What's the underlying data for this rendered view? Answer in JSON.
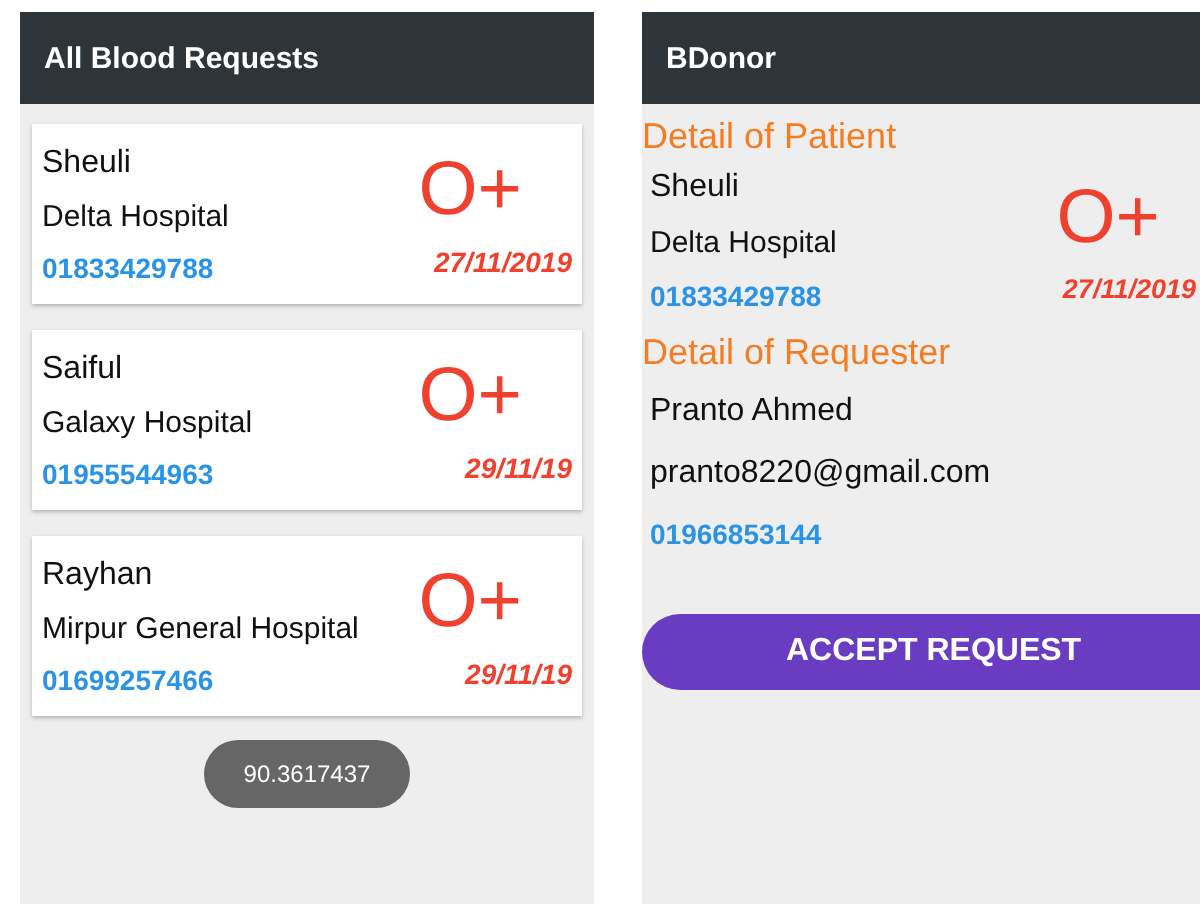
{
  "list_screen": {
    "title": "All Blood Requests",
    "requests": [
      {
        "name": "Sheuli",
        "hospital": "Delta Hospital",
        "phone": "01833429788",
        "blood_group": "O+",
        "date": "27/11/2019"
      },
      {
        "name": "Saiful",
        "hospital": "Galaxy Hospital",
        "phone": "01955544963",
        "blood_group": "O+",
        "date": "29/11/19"
      },
      {
        "name": "Rayhan",
        "hospital": "Mirpur General Hospital",
        "phone": "01699257466",
        "blood_group": "O+",
        "date": "29/11/19"
      }
    ],
    "toast": "90.3617437"
  },
  "detail_screen": {
    "title": "BDonor",
    "patient_heading": "Detail of Patient",
    "patient": {
      "name": "Sheuli",
      "hospital": "Delta Hospital",
      "phone": "01833429788",
      "blood_group": "O+",
      "date": "27/11/2019"
    },
    "requester_heading": "Detail of Requester",
    "requester": {
      "name": "Pranto Ahmed",
      "email": "pranto8220@gmail.com",
      "phone": "01966853144"
    },
    "accept_button": "ACCEPT REQUEST"
  }
}
